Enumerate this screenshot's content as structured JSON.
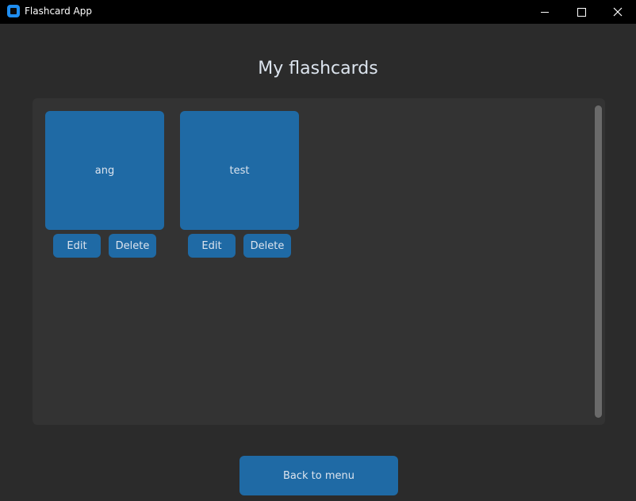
{
  "window": {
    "title": "Flashcard App",
    "icon": "app-icon"
  },
  "page": {
    "title": "My flashcards"
  },
  "cards": [
    {
      "label": "ang",
      "edit_label": "Edit",
      "delete_label": "Delete"
    },
    {
      "label": "test",
      "edit_label": "Edit",
      "delete_label": "Delete"
    }
  ],
  "footer": {
    "back_label": "Back to menu"
  },
  "colors": {
    "accent": "#1f6aa5",
    "background": "#2b2b2b",
    "panel": "#333333",
    "text": "#dce4ee"
  }
}
